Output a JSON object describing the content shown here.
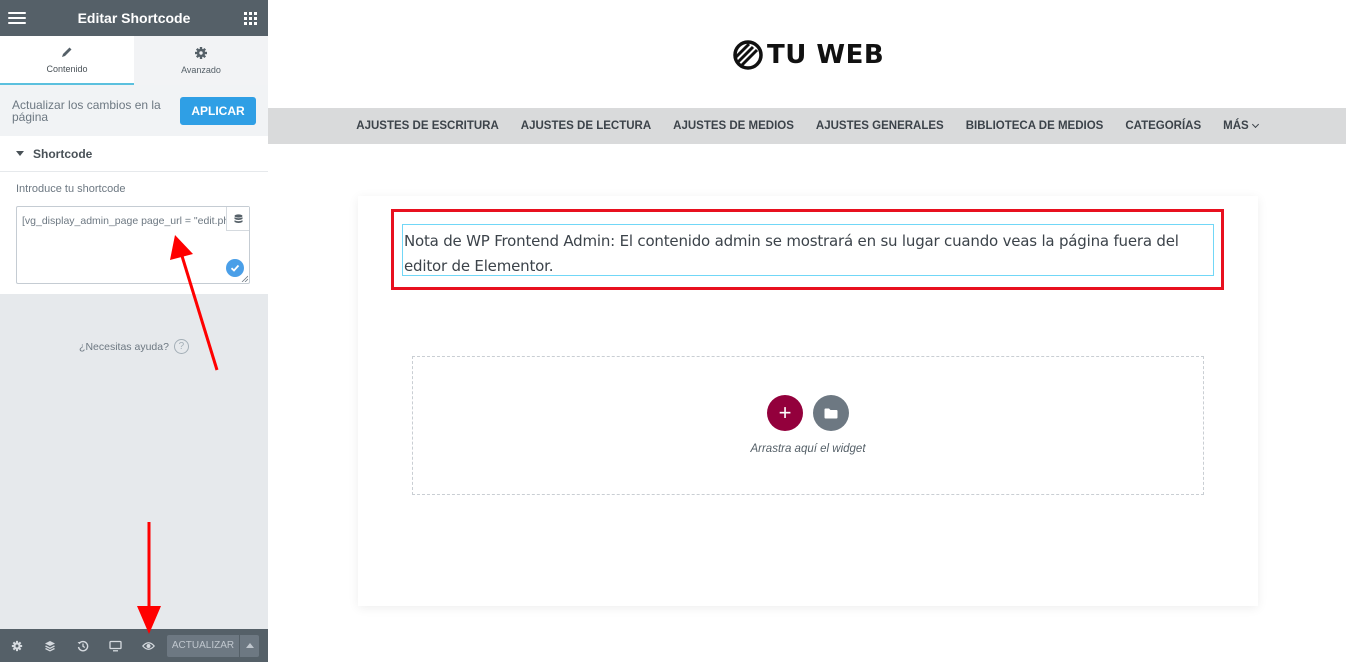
{
  "panel": {
    "title": "Editar Shortcode",
    "tabs": [
      {
        "label": "Contenido",
        "icon": "pencil-icon",
        "active": true
      },
      {
        "label": "Avanzado",
        "icon": "gear-icon",
        "active": false
      }
    ],
    "apply_text": "Actualizar los cambios en la página",
    "apply_button": "APLICAR",
    "section_title": "Shortcode",
    "field_label": "Introduce tu shortcode",
    "field_value": "[vg_display_admin_page page_url = \"edit.ph",
    "help_text": "¿Necesitas ayuda?",
    "help_icon": "?",
    "footer": {
      "update_button": "ACTUALIZAR",
      "icons": [
        "gear-icon",
        "layers-icon",
        "history-icon",
        "responsive-icon",
        "preview-eye-icon"
      ]
    }
  },
  "preview": {
    "logo_text": "TU WEB",
    "nav": [
      "AJUSTES DE ESCRITURA",
      "AJUSTES DE LECTURA",
      "AJUSTES DE MEDIOS",
      "AJUSTES GENERALES",
      "BIBLIOTECA DE MEDIOS",
      "CATEGORÍAS",
      "MÁS"
    ],
    "note": "Nota de WP Frontend Admin: El contenido admin se mostrará en su lugar cuando veas la página fuera del editor de Elementor.",
    "drop_text": "Arrastra aquí el widget",
    "add_symbol": "+"
  },
  "colors": {
    "panel_header": "#556068",
    "apply_button": "#2f9fe5",
    "highlight_border": "#e8101f",
    "add_button": "#93003c",
    "annotation_arrow": "#ff0000"
  }
}
